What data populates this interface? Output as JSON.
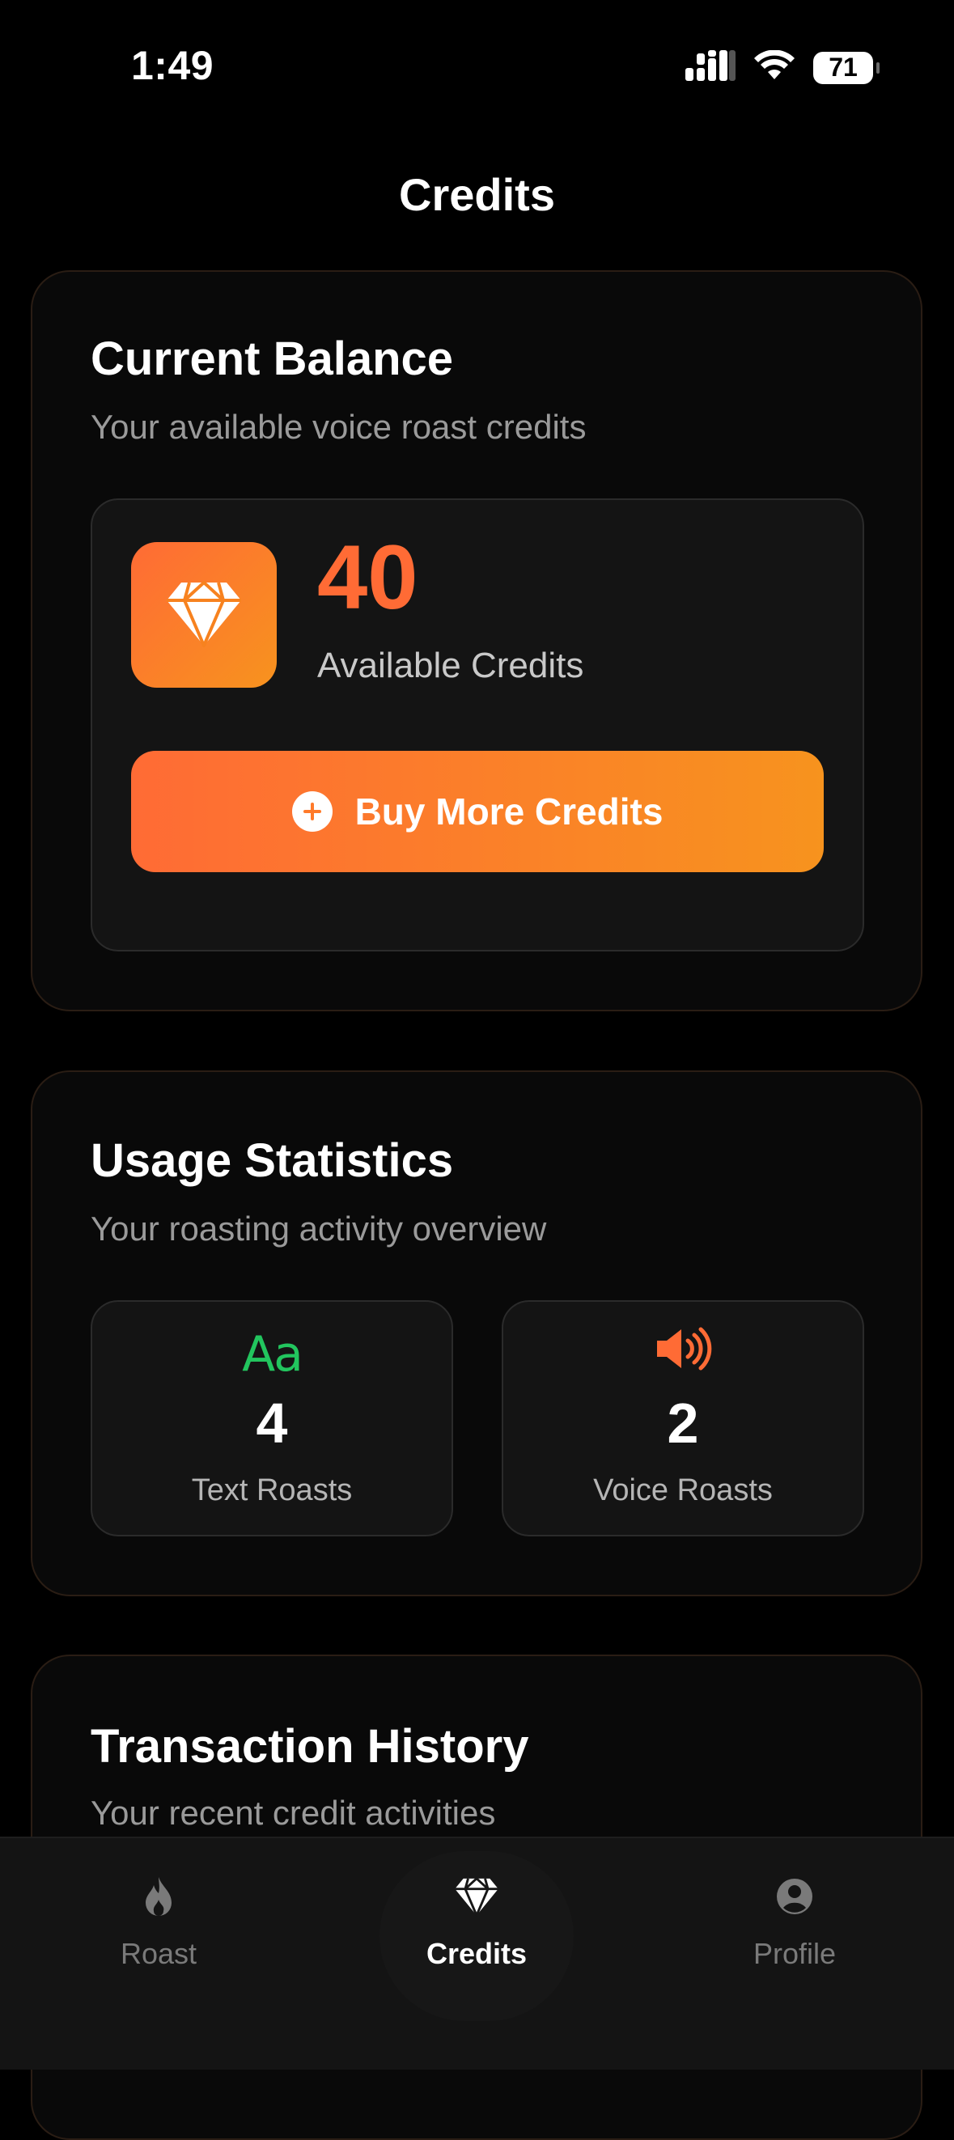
{
  "status_bar": {
    "time": "1:49",
    "battery": "71",
    "icons": [
      "cellular-signal-icon",
      "wifi-icon",
      "battery-icon"
    ]
  },
  "page": {
    "title": "Credits"
  },
  "balance": {
    "title": "Current Balance",
    "subtitle": "Your available voice roast credits",
    "credits": "40",
    "credits_label": "Available Credits",
    "buy_label": "Buy More Credits"
  },
  "usage": {
    "title": "Usage Statistics",
    "subtitle": "Your roasting activity overview",
    "stats": [
      {
        "icon": "text-icon",
        "icon_glyph": "Aa",
        "value": "4",
        "label": "Text Roasts",
        "color": "#22c55e"
      },
      {
        "icon": "speaker-icon",
        "value": "2",
        "label": "Voice Roasts",
        "color": "#ff6b35"
      }
    ]
  },
  "history": {
    "title": "Transaction History",
    "subtitle": "Your recent credit activities"
  },
  "tabs": [
    {
      "label": "Roast",
      "icon": "flame-icon",
      "active": false
    },
    {
      "label": "Credits",
      "icon": "diamond-icon",
      "active": true
    },
    {
      "label": "Profile",
      "icon": "person-icon",
      "active": false
    }
  ],
  "colors": {
    "accent": "#ff6b35",
    "accent_end": "#f7931e",
    "green": "#22c55e",
    "background": "#000000",
    "card": "#090909"
  }
}
